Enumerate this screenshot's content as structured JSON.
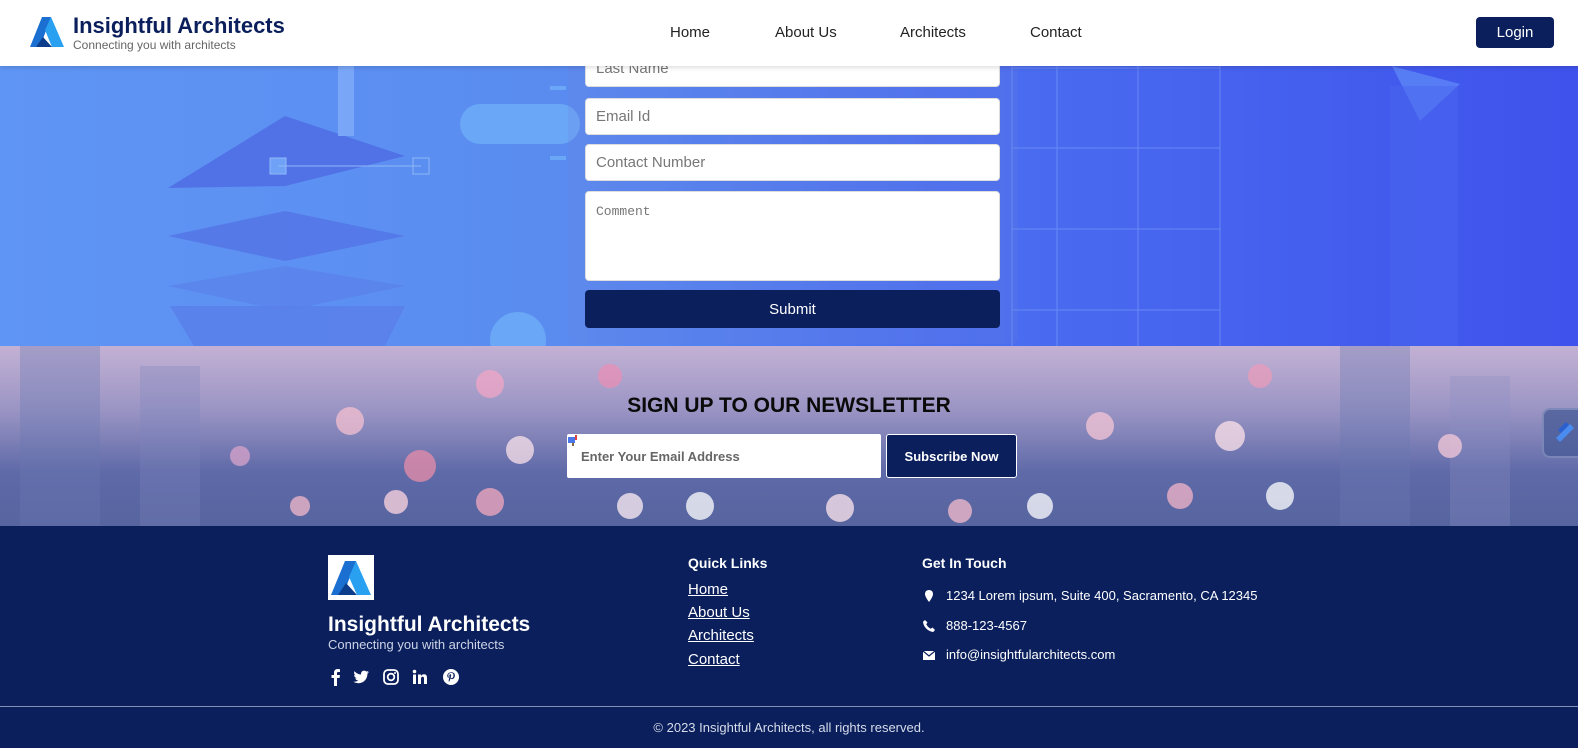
{
  "header": {
    "brand_title": "Insightful Architects",
    "brand_subtitle": "Connecting you with architects",
    "nav": [
      "Home",
      "About Us",
      "Architects",
      "Contact"
    ],
    "login_label": "Login"
  },
  "contact_form": {
    "last_name_placeholder": "Last Name",
    "email_placeholder": "Email Id",
    "phone_placeholder": "Contact Number",
    "comment_placeholder": "Comment",
    "submit_label": "Submit"
  },
  "newsletter": {
    "title": "SIGN UP TO OUR NEWSLETTER",
    "email_placeholder": "Enter Your Email Address",
    "subscribe_label": "Subscribe Now"
  },
  "footer": {
    "brand_title": "Insightful Architects",
    "brand_subtitle": "Connecting you with architects",
    "social_icons": [
      "facebook-icon",
      "twitter-icon",
      "instagram-icon",
      "linkedin-icon",
      "pinterest-icon"
    ],
    "quick_links_heading": "Quick Links",
    "quick_links": [
      "Home",
      "About Us",
      "Architects",
      "Contact"
    ],
    "contact_heading": "Get In Touch",
    "address": "1234 Lorem ipsum, Suite 400, Sacramento, CA 12345",
    "phone": "888-123-4567",
    "email": "info@insightfularchitects.com",
    "copyright": "© 2023 Insightful Architects, all rights reserved."
  },
  "colors": {
    "brand_navy": "#0a1f5c",
    "hero_blue": "#5a8cf0",
    "white": "#ffffff"
  }
}
